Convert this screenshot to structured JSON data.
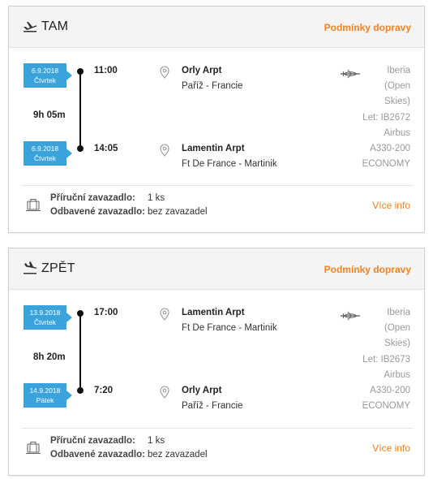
{
  "flights": [
    {
      "direction": "TAM",
      "conditions_link": "Podmínky dopravy",
      "departure": {
        "date": "6.9.2018",
        "weekday": "Čtvrtek",
        "time": "11:00",
        "airport": "Orly Arpt",
        "place": "Paříž - Francie"
      },
      "duration": "9h 05m",
      "arrival": {
        "date": "6.9.2018",
        "weekday": "Čtvrtek",
        "time": "14:05",
        "airport": "Lamentin Arpt",
        "place": "Ft De France - Martinik"
      },
      "airline": "Iberia",
      "airline_sub1": "(Open",
      "airline_sub2": "Skies)",
      "flight_no": "Let: IB2672",
      "aircraft1": "Airbus",
      "aircraft2": "A330-200",
      "cabin": "ECONOMY",
      "hand_baggage_label": "Příruční zavazadlo:",
      "hand_baggage_value": "1 ks",
      "checked_baggage_label": "Odbavené zavazadlo:",
      "checked_baggage_value": "bez zavazadel",
      "more_info": "Více info"
    },
    {
      "direction": "ZPĚT",
      "conditions_link": "Podmínky dopravy",
      "departure": {
        "date": "13.9.2018",
        "weekday": "Čtvrtek",
        "time": "17:00",
        "airport": "Lamentin Arpt",
        "place": "Ft De France - Martinik"
      },
      "duration": "8h 20m",
      "arrival": {
        "date": "14.9.2018",
        "weekday": "Pátek",
        "time": "7:20",
        "airport": "Orly Arpt",
        "place": "Paříž - Francie"
      },
      "airline": "Iberia",
      "airline_sub1": "(Open",
      "airline_sub2": "Skies)",
      "flight_no": "Let: IB2673",
      "aircraft1": "Airbus",
      "aircraft2": "A330-200",
      "cabin": "ECONOMY",
      "hand_baggage_label": "Příruční zavazadlo:",
      "hand_baggage_value": "1 ks",
      "checked_baggage_label": "Odbavené zavazadlo:",
      "checked_baggage_value": "bez zavazadel",
      "more_info": "Více info"
    }
  ],
  "icons": {
    "outbound": "plane-takeoff-icon",
    "inbound": "plane-landing-icon",
    "location": "map-pin-icon",
    "airline": "airline-logo-icon",
    "baggage": "suitcase-icon"
  },
  "colors": {
    "accent": "#f58220",
    "date_badge": "#3aa3dc",
    "muted": "#999999"
  }
}
